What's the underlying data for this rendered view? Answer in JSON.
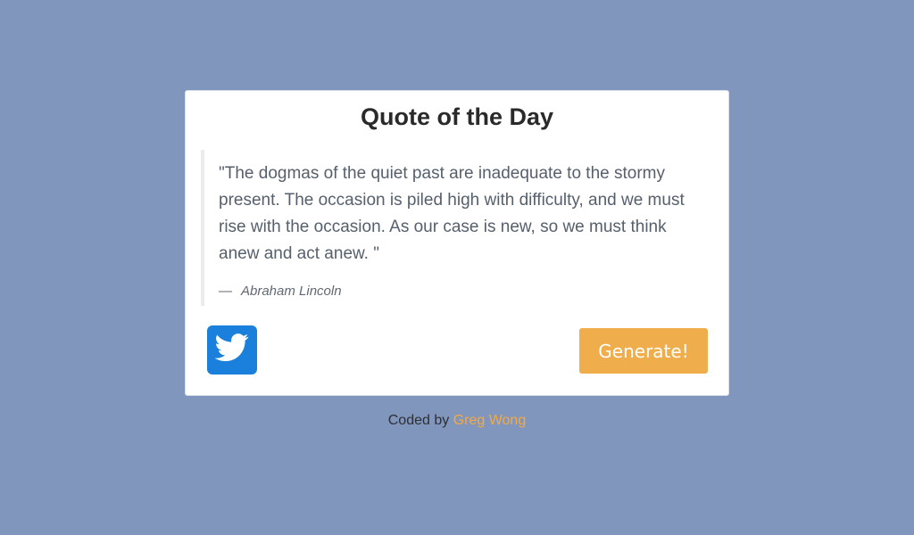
{
  "card": {
    "title": "Quote of the Day",
    "quote": "\"The dogmas of the quiet past are inadequate to the stormy present. The occasion is piled high with difficulty, and we must rise with the occasion. As our case is new, so we must think anew and act anew. \"",
    "dash": "—",
    "author": "Abraham Lincoln",
    "tweet_icon": "twitter-bird-icon",
    "generate_label": "Generate!"
  },
  "footer": {
    "prefix": "Coded by",
    "author_link": "Greg Wong"
  },
  "colors": {
    "background": "#8196bd",
    "accent": "#efad4c",
    "twitter": "#1b7fdc",
    "link": "#f4a942"
  }
}
